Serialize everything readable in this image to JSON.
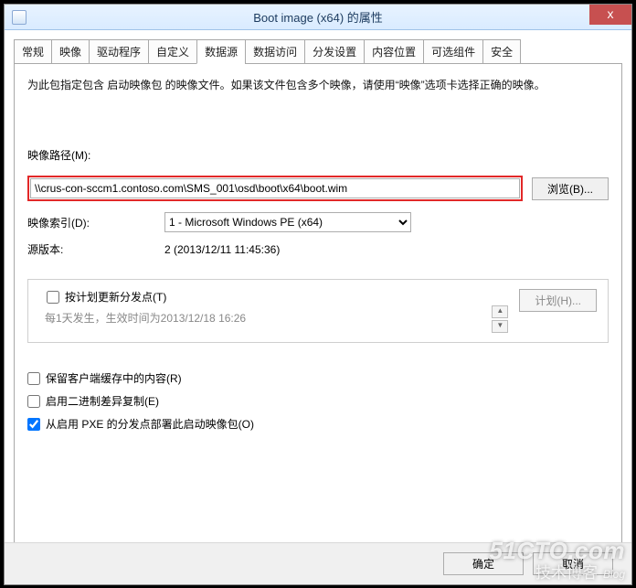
{
  "window": {
    "title": "Boot image (x64) 的属性",
    "close": "x"
  },
  "tabs": [
    "常规",
    "映像",
    "驱动程序",
    "自定义",
    "数据源",
    "数据访问",
    "分发设置",
    "内容位置",
    "可选组件",
    "安全"
  ],
  "active_tab_index": 4,
  "body": {
    "description": "为此包指定包含 启动映像包 的映像文件。如果该文件包含多个映像，请使用“映像”选项卡选择正确的映像。",
    "path_label": "映像路径(M):",
    "path_value": "\\\\crus-con-sccm1.contoso.com\\SMS_001\\osd\\boot\\x64\\boot.wim",
    "browse_btn": "浏览(B)...",
    "index_label": "映像索引(D):",
    "index_selected": "1 - Microsoft Windows PE (x64)",
    "index_options": [
      "1 - Microsoft Windows PE (x64)"
    ],
    "version_label": "源版本:",
    "version_value": "2 (2013/12/11 11:45:36)",
    "schedule": {
      "checkbox_label": "按计划更新分发点(T)",
      "checked": false,
      "text": "每1天发生，生效时间为2013/12/18 16:26",
      "schedule_btn": "计划(H)..."
    },
    "options": {
      "keep_cache": {
        "label": "保留客户端缓存中的内容(R)",
        "checked": false
      },
      "binary_diff": {
        "label": "启用二进制差异复制(E)",
        "checked": false
      },
      "pxe_deploy": {
        "label": "从启用 PXE 的分发点部署此启动映像包(O)",
        "checked": true
      }
    }
  },
  "buttons": {
    "ok": "确定",
    "cancel": "取消"
  },
  "watermark": {
    "line1": "51CTO.com",
    "line2": "技术博客",
    "line2_small": "Blog"
  }
}
